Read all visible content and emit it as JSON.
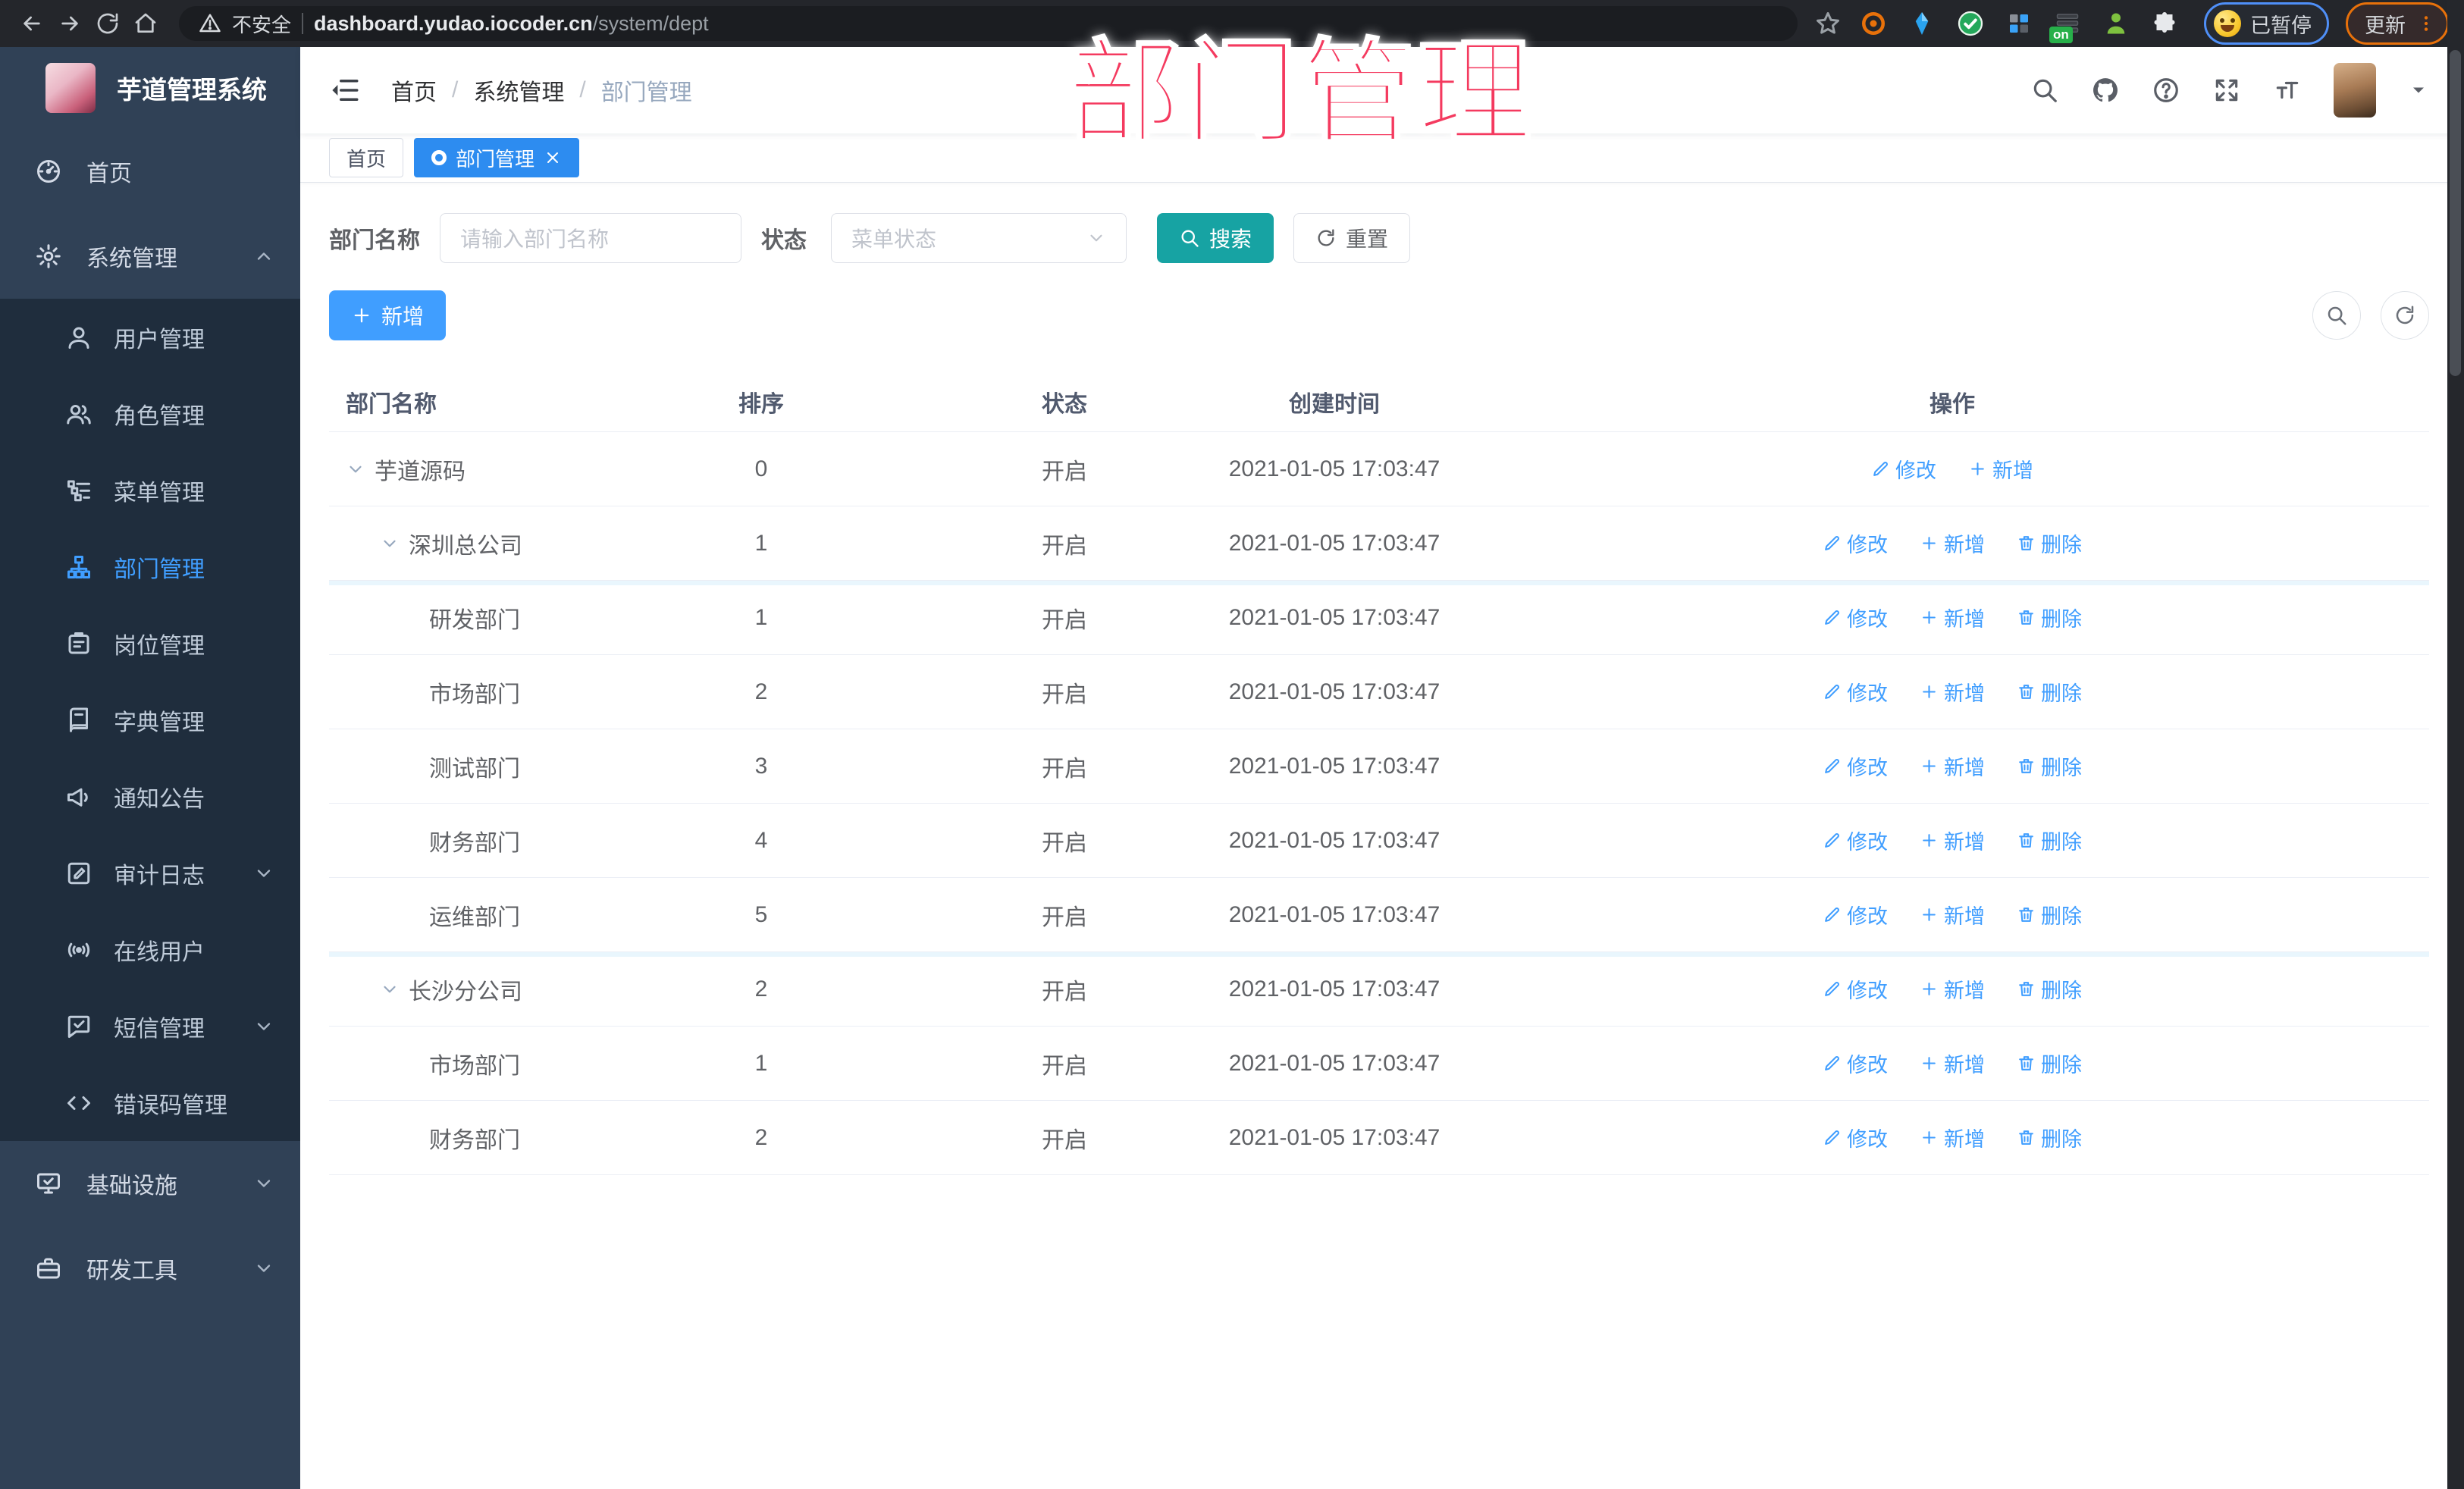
{
  "annotation": {
    "watermark": "部门管理"
  },
  "colors": {
    "primary": "#409eff",
    "teal": "#17a3a3",
    "sidebar": "#304156",
    "sidebar_dark": "#1f2d3d",
    "watermark_pink": "#f43a5f",
    "active_tab": "#2d8cf0"
  },
  "browser": {
    "security_label": "不安全",
    "url_host": "dashboard.yudao.iocoder.cn",
    "url_path": "/system/dept",
    "extension_on_badge": "on",
    "paused_badge": "已暂停",
    "update_label": "更新"
  },
  "sidebar": {
    "app_title": "芋道管理系统",
    "items": [
      {
        "key": "home",
        "label": "首页",
        "icon": "dashboard",
        "level": 0
      },
      {
        "key": "system",
        "label": "系统管理",
        "icon": "gear",
        "level": 0,
        "chevron": "up"
      },
      {
        "key": "user",
        "label": "用户管理",
        "icon": "user",
        "level": 1
      },
      {
        "key": "role",
        "label": "角色管理",
        "icon": "users",
        "level": 1
      },
      {
        "key": "menu",
        "label": "菜单管理",
        "icon": "menutree",
        "level": 1
      },
      {
        "key": "dept",
        "label": "部门管理",
        "icon": "org",
        "level": 1,
        "active": true
      },
      {
        "key": "post",
        "label": "岗位管理",
        "icon": "idcard",
        "level": 1
      },
      {
        "key": "dict",
        "label": "字典管理",
        "icon": "book",
        "level": 1
      },
      {
        "key": "notice",
        "label": "通知公告",
        "icon": "megaphone",
        "level": 1
      },
      {
        "key": "audit",
        "label": "审计日志",
        "icon": "editlog",
        "level": 1,
        "chevron": "down"
      },
      {
        "key": "online",
        "label": "在线用户",
        "icon": "signal",
        "level": 1
      },
      {
        "key": "sms",
        "label": "短信管理",
        "icon": "chatcheck",
        "level": 1,
        "chevron": "down"
      },
      {
        "key": "errcode",
        "label": "错误码管理",
        "icon": "codetag",
        "level": 1
      },
      {
        "key": "infra",
        "label": "基础设施",
        "icon": "monitor",
        "level": 0,
        "chevron": "down"
      },
      {
        "key": "devtool",
        "label": "研发工具",
        "icon": "toolbox",
        "level": 0,
        "chevron": "down"
      }
    ]
  },
  "header": {
    "breadcrumb": [
      "首页",
      "系统管理",
      "部门管理"
    ]
  },
  "tabs": [
    {
      "key": "home",
      "label": "首页",
      "active": false,
      "closable": false
    },
    {
      "key": "dept",
      "label": "部门管理",
      "active": true,
      "closable": true
    }
  ],
  "filters": {
    "dept_label": "部门名称",
    "dept_placeholder": "请输入部门名称",
    "status_label": "状态",
    "status_placeholder": "菜单状态",
    "search_label": "搜索",
    "reset_label": "重置"
  },
  "toolbar": {
    "add_label": "新增"
  },
  "table": {
    "columns": [
      "部门名称",
      "排序",
      "状态",
      "创建时间",
      "操作"
    ],
    "action_labels": {
      "edit": "修改",
      "add": "新增",
      "delete": "删除"
    },
    "rows": [
      {
        "name": "芋道源码",
        "level": 0,
        "expandable": true,
        "sort": "0",
        "status": "开启",
        "created": "2021-01-05 17:03:47",
        "actions": [
          "edit",
          "add"
        ]
      },
      {
        "name": "深圳总公司",
        "level": 1,
        "expandable": true,
        "sort": "1",
        "status": "开启",
        "created": "2021-01-05 17:03:47",
        "actions": [
          "edit",
          "add",
          "delete"
        ]
      },
      {
        "name": "研发部门",
        "level": 2,
        "expandable": false,
        "sort": "1",
        "status": "开启",
        "created": "2021-01-05 17:03:47",
        "actions": [
          "edit",
          "add",
          "delete"
        ],
        "blue_sep": true
      },
      {
        "name": "市场部门",
        "level": 2,
        "expandable": false,
        "sort": "2",
        "status": "开启",
        "created": "2021-01-05 17:03:47",
        "actions": [
          "edit",
          "add",
          "delete"
        ]
      },
      {
        "name": "测试部门",
        "level": 2,
        "expandable": false,
        "sort": "3",
        "status": "开启",
        "created": "2021-01-05 17:03:47",
        "actions": [
          "edit",
          "add",
          "delete"
        ]
      },
      {
        "name": "财务部门",
        "level": 2,
        "expandable": false,
        "sort": "4",
        "status": "开启",
        "created": "2021-01-05 17:03:47",
        "actions": [
          "edit",
          "add",
          "delete"
        ]
      },
      {
        "name": "运维部门",
        "level": 2,
        "expandable": false,
        "sort": "5",
        "status": "开启",
        "created": "2021-01-05 17:03:47",
        "actions": [
          "edit",
          "add",
          "delete"
        ]
      },
      {
        "name": "长沙分公司",
        "level": 1,
        "expandable": true,
        "sort": "2",
        "status": "开启",
        "created": "2021-01-05 17:03:47",
        "actions": [
          "edit",
          "add",
          "delete"
        ],
        "blue_sep": true
      },
      {
        "name": "市场部门",
        "level": 2,
        "expandable": false,
        "sort": "1",
        "status": "开启",
        "created": "2021-01-05 17:03:47",
        "actions": [
          "edit",
          "add",
          "delete"
        ]
      },
      {
        "name": "财务部门",
        "level": 2,
        "expandable": false,
        "sort": "2",
        "status": "开启",
        "created": "2021-01-05 17:03:47",
        "actions": [
          "edit",
          "add",
          "delete"
        ]
      }
    ]
  }
}
